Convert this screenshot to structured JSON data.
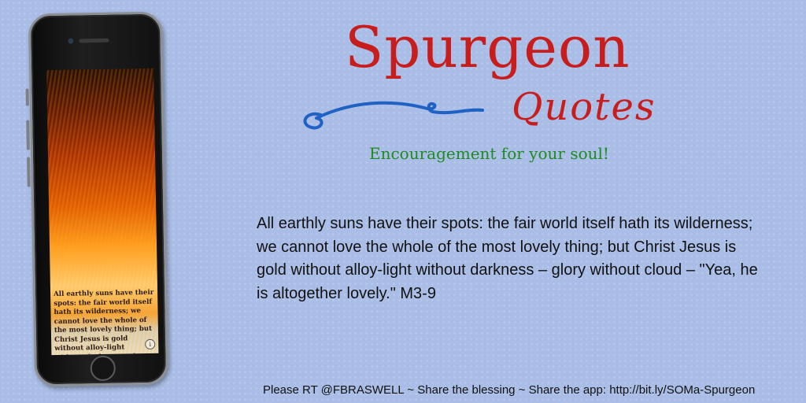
{
  "header": {
    "title": "Spurgeon",
    "script_word": "Quotes",
    "tagline": "Encouragement for your soul!"
  },
  "phone": {
    "screen_quote": "All earthly suns have their spots: the fair world itself hath its wilderness; we cannot love the whole of the most lovely thing; but Christ Jesus is gold without alloy-light without darkness – glory without cloud – \"Yea, he is",
    "info_glyph": "i",
    "info_icon": "info-icon"
  },
  "quote": {
    "text": "All earthly suns have their spots: the fair world itself hath its wilderness; we cannot love the whole of the most lovely thing; but Christ Jesus is gold without alloy-light without darkness – glory without cloud – \"Yea, he is altogether lovely.\" M3-9"
  },
  "footer": {
    "text": "Please RT @FBRASWELL ~ Share the blessing ~ Share the app: http://bit.ly/SOMa-Spurgeon"
  },
  "colors": {
    "background": "#a9bde6",
    "title_red": "#c81d1d",
    "tagline_green": "#1f8a1f",
    "swash_blue": "#1f62c4"
  }
}
